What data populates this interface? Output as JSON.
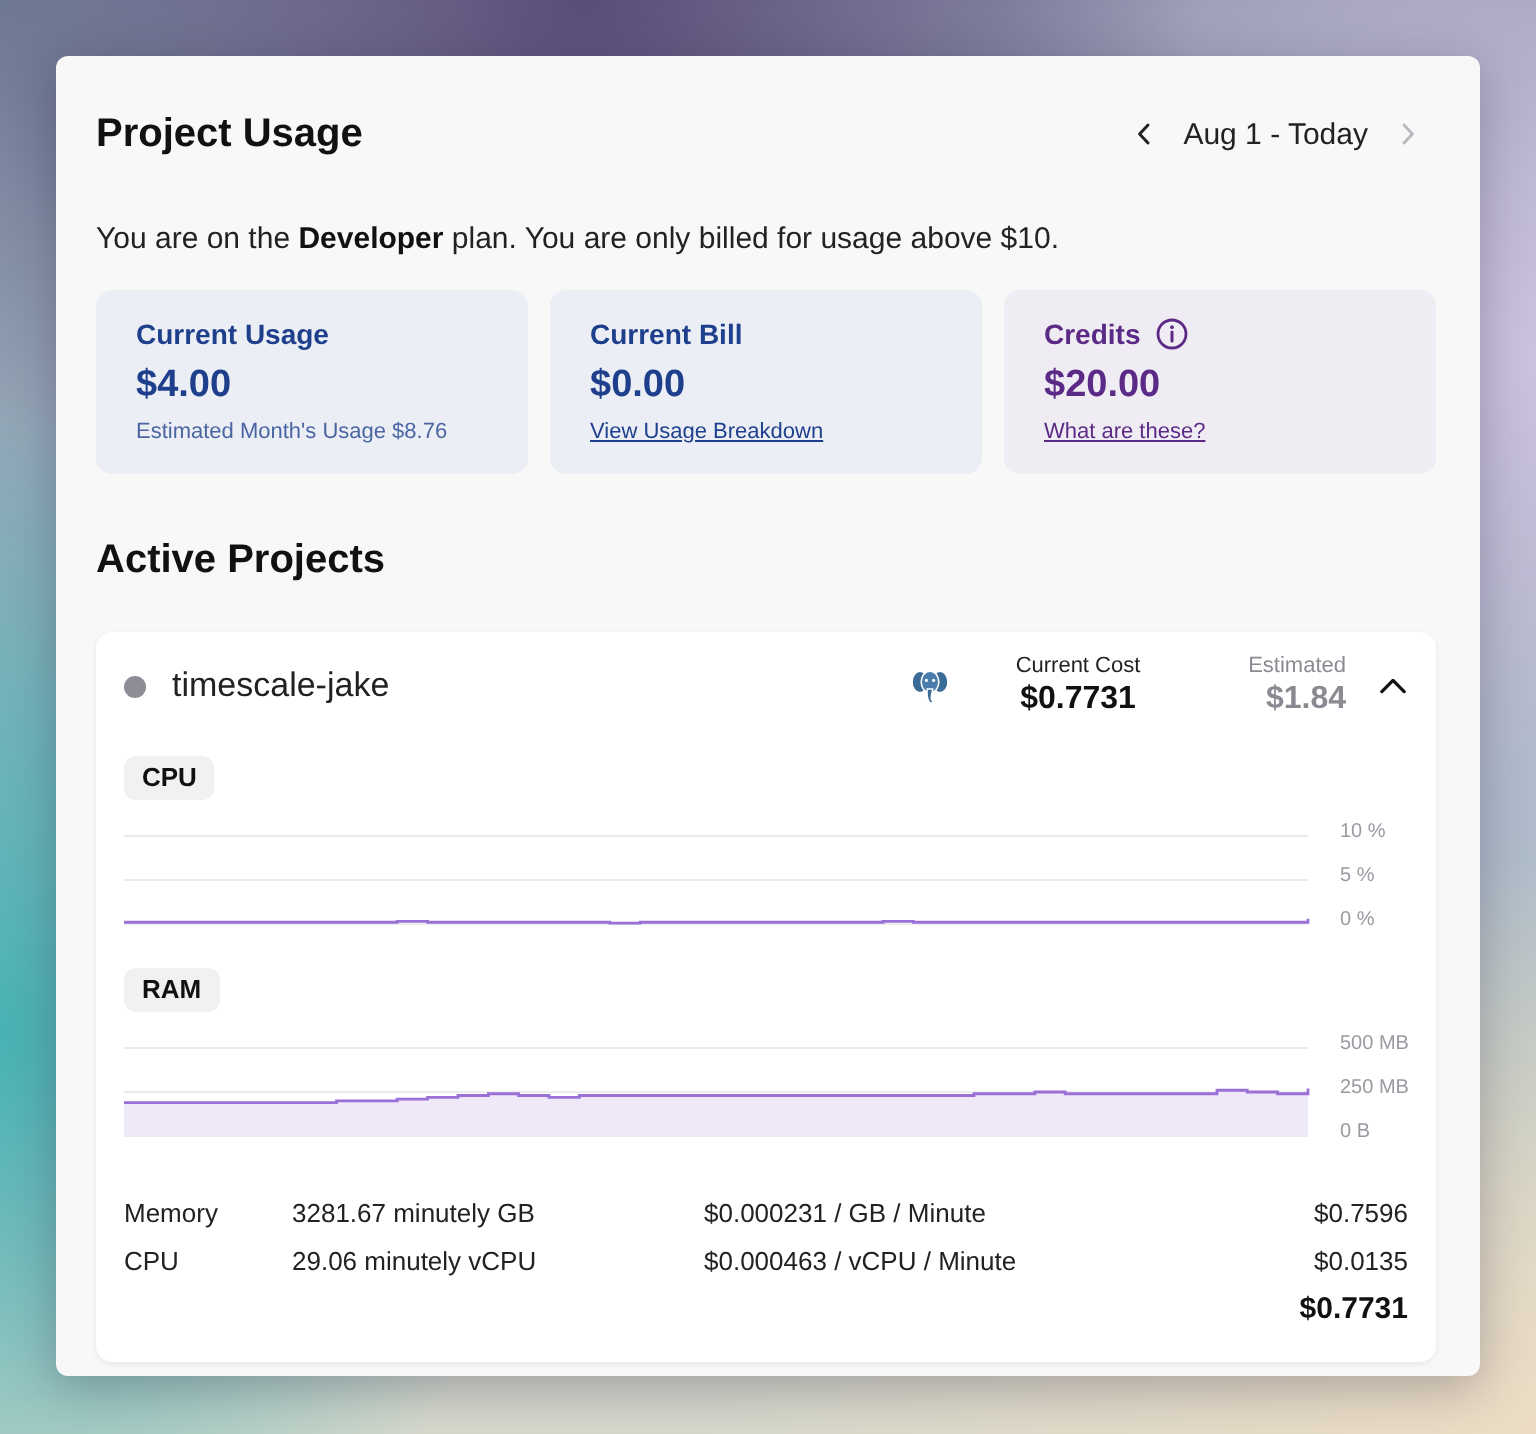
{
  "header": {
    "title": "Project Usage",
    "date_range": {
      "label": "Aug 1 - Today",
      "prev_disabled": false,
      "next_disabled": true
    }
  },
  "plan_notice": "You are on the **Developer** plan. You are only billed for usage above $10.",
  "summary_cards": [
    {
      "label": "Current Usage",
      "value": "$4.00",
      "note": {
        "kind": "text",
        "text": "Estimated Month's Usage $8.76"
      },
      "info_icon": false,
      "color": "#1e3f8c"
    },
    {
      "label": "Current Bill",
      "value": "$0.00",
      "note": {
        "kind": "link",
        "text": "View Usage Breakdown"
      },
      "info_icon": false,
      "color": "#1e3f8c"
    },
    {
      "label": "Credits",
      "value": "$20.00",
      "note": {
        "kind": "link",
        "text": "What are these?"
      },
      "info_icon": true,
      "color": "#5b2a86"
    }
  ],
  "section_title": "Active Projects",
  "projects": [
    {
      "name": "timescale-jake",
      "color": "#8e8c96",
      "expanded": true,
      "current_cost_label": "Current Cost",
      "current_cost": "$0.7731",
      "estimated_label": "Estimated",
      "estimated": "$1.84",
      "charts": [
        {
          "chart_data": {
            "type": "line",
            "title": "CPU",
            "ylim": [
              0,
              10
            ],
            "yticks": [
              {
                "value": 0,
                "label": "0 %"
              },
              {
                "value": 5,
                "label": "5 %"
              },
              {
                "value": 10,
                "label": "10 %"
              }
            ],
            "series": [
              {
                "color": "#9a6fd6",
                "values": [
                  0.2,
                  0.2,
                  0.2,
                  0.2,
                  0.2,
                  0.2,
                  0.2,
                  0.2,
                  0.2,
                  0.3,
                  0.2,
                  0.2,
                  0.2,
                  0.2,
                  0.2,
                  0.2,
                  0.1,
                  0.2,
                  0.2,
                  0.2,
                  0.2,
                  0.2,
                  0.2,
                  0.2,
                  0.2,
                  0.3,
                  0.2,
                  0.2,
                  0.2,
                  0.2,
                  0.2,
                  0.2,
                  0.2,
                  0.2,
                  0.2,
                  0.2,
                  0.2,
                  0.2,
                  0.2,
                  0.6
                ]
              }
            ]
          }
        },
        {
          "chart_data": {
            "type": "area",
            "title": "RAM",
            "ylim": [
              0,
              500
            ],
            "yticks": [
              {
                "value": 0,
                "label": "0 B"
              },
              {
                "value": 250,
                "label": "250 MB"
              },
              {
                "value": 500,
                "label": "500 MB"
              }
            ],
            "series": [
              {
                "color": "#9a6fd6",
                "values": [
                  190,
                  190,
                  190,
                  190,
                  190,
                  190,
                  190,
                  200,
                  200,
                  210,
                  220,
                  230,
                  240,
                  230,
                  220,
                  230,
                  230,
                  230,
                  230,
                  230,
                  230,
                  230,
                  230,
                  230,
                  230,
                  230,
                  230,
                  230,
                  240,
                  240,
                  250,
                  240,
                  240,
                  240,
                  240,
                  240,
                  260,
                  250,
                  240,
                  270
                ]
              }
            ]
          }
        }
      ],
      "usage_rows": [
        {
          "resource": "Memory",
          "quantity": "3281.67 minutely GB",
          "rate": "$0.000231 / GB / Minute",
          "cost": "$0.7596"
        },
        {
          "resource": "CPU",
          "quantity": "29.06 minutely vCPU",
          "rate": "$0.000463 / vCPU / Minute",
          "cost": "$0.0135"
        }
      ],
      "total": "$0.7731"
    }
  ]
}
